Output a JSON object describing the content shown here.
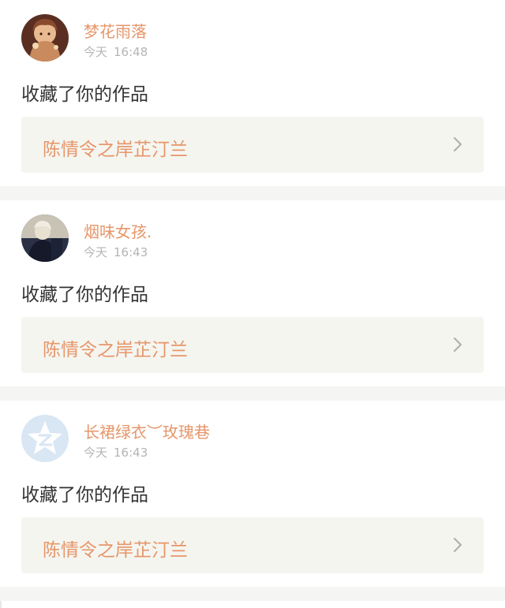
{
  "notifications": [
    {
      "username": "梦花雨落",
      "day": "今天",
      "time": "16:48",
      "action": "收藏了你的作品",
      "work_title": "陈情令之岸芷汀兰",
      "avatar_icon": "anime-girl-avatar",
      "avatar_colors": [
        "#6b3a2a",
        "#e9b98f"
      ]
    },
    {
      "username": "烟味女孩.",
      "day": "今天",
      "time": "16:43",
      "action": "收藏了你的作品",
      "work_title": "陈情令之岸芷汀兰",
      "avatar_icon": "photo-avatar",
      "avatar_colors": [
        "#1c2233",
        "#d8d0c0"
      ]
    },
    {
      "username": "长裙绿衣︶玫瑰巷",
      "day": "今天",
      "time": "16:43",
      "action": "收藏了你的作品",
      "work_title": "陈情令之岸芷汀兰",
      "avatar_icon": "default-z-star-avatar",
      "avatar_colors": [
        "#d9e6f3",
        "#ffffff"
      ]
    }
  ],
  "colors": {
    "accent": "#e6966a",
    "time_text": "#b5b5b5",
    "body_text": "#333333",
    "link_bg": "#f5f5f0",
    "divider": "#f5f5f3"
  }
}
